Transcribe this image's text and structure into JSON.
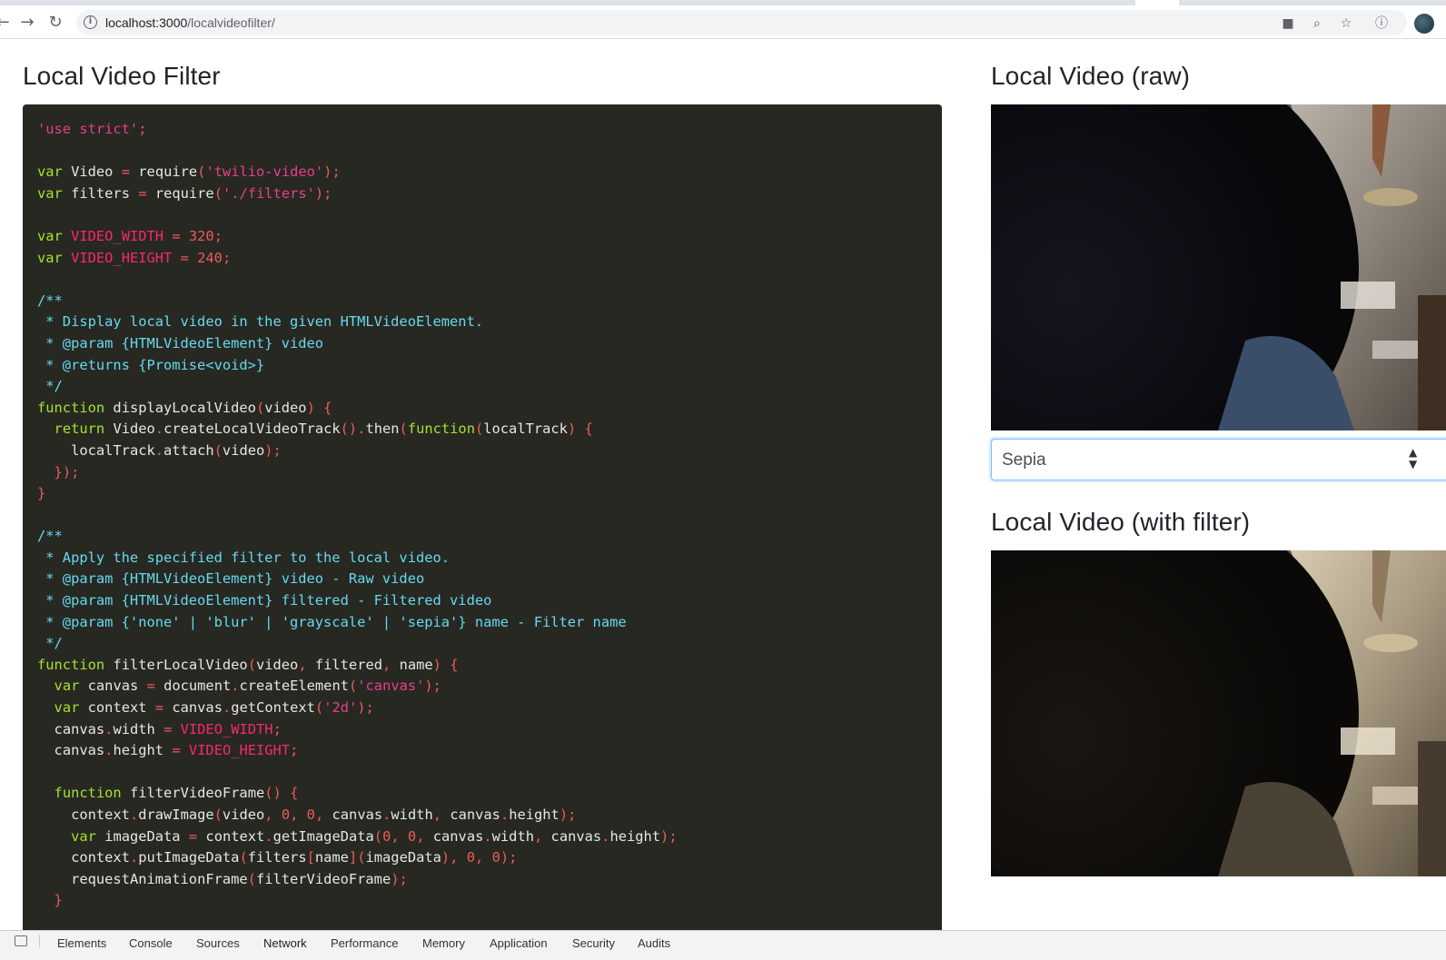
{
  "browser": {
    "url_host": "localhost:3000",
    "url_path": "/localvideofilter/",
    "icons": [
      "back-icon",
      "forward-icon",
      "reload-icon",
      "info-icon",
      "camera-icon",
      "zoom-icon",
      "star-icon",
      "extension-icon",
      "profile-avatar"
    ]
  },
  "page": {
    "code_title": "Local Video Filter",
    "raw_title": "Local Video (raw)",
    "filtered_title": "Local Video (with filter)",
    "filter_select": {
      "value": "Sepia"
    }
  },
  "code_lines": [
    "'use strict';",
    "",
    "var Video = require('twilio-video');",
    "var filters = require('./filters');",
    "",
    "var VIDEO_WIDTH = 320;",
    "var VIDEO_HEIGHT = 240;",
    "",
    "/**",
    " * Display local video in the given HTMLVideoElement.",
    " * @param {HTMLVideoElement} video",
    " * @returns {Promise<void>}",
    " */",
    "function displayLocalVideo(video) {",
    "  return Video.createLocalVideoTrack().then(function(localTrack) {",
    "    localTrack.attach(video);",
    "  });",
    "}",
    "",
    "/**",
    " * Apply the specified filter to the local video.",
    " * @param {HTMLVideoElement} video - Raw video",
    " * @param {HTMLVideoElement} filtered - Filtered video",
    " * @param {'none' | 'blur' | 'grayscale' | 'sepia'} name - Filter name",
    " */",
    "function filterLocalVideo(video, filtered, name) {",
    "  var canvas = document.createElement('canvas');",
    "  var context = canvas.getContext('2d');",
    "  canvas.width = VIDEO_WIDTH;",
    "  canvas.height = VIDEO_HEIGHT;",
    "",
    "  function filterVideoFrame() {",
    "    context.drawImage(video, 0, 0, canvas.width, canvas.height);",
    "    var imageData = context.getImageData(0, 0, canvas.width, canvas.height);",
    "    context.putImageData(filters[name](imageData), 0, 0);",
    "    requestAnimationFrame(filterVideoFrame);",
    "  }"
  ],
  "devtools": {
    "tabs": [
      "Elements",
      "Console",
      "Sources",
      "Network",
      "Performance",
      "Memory",
      "Application",
      "Security",
      "Audits"
    ],
    "active_tab": "Network"
  }
}
